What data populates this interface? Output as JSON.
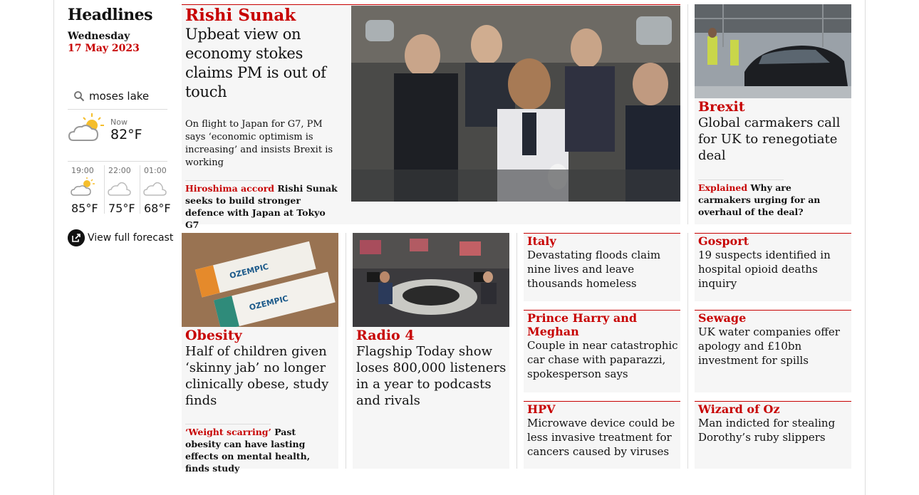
{
  "header": {
    "title": "Headlines",
    "day": "Wednesday",
    "date": "17 May 2023"
  },
  "weather": {
    "location": "moses lake",
    "now": {
      "label": "Now",
      "temp": "82°F",
      "icon": "partly-cloudy-sun-icon"
    },
    "forecast": [
      {
        "time": "19:00",
        "temp": "85°F",
        "icon": "partly-cloudy-sun-icon"
      },
      {
        "time": "22:00",
        "temp": "75°F",
        "icon": "cloudy-moon-icon"
      },
      {
        "time": "01:00",
        "temp": "68°F",
        "icon": "cloudy-moon-icon"
      }
    ],
    "view_full_forecast": "View full forecast"
  },
  "lead": {
    "kicker": "Rishi Sunak",
    "headline": "Upbeat view on economy stokes claims PM is out of touch",
    "standfirst": "On flight to Japan for G7, PM says ‘economic optimism is increasing’ and insists Brexit is working",
    "sublink_kicker": "Hiroshima accord",
    "sublink_text": " Rishi Sunak seeks to build stronger defence with Japan at Tokyo G7"
  },
  "brexit": {
    "kicker": "Brexit",
    "headline": "Global carmakers call for UK to renegotiate deal",
    "sublink_kicker": "Explained",
    "sublink_text": " Why are carmakers urging for an overhaul of the deal?"
  },
  "obesity": {
    "kicker": "Obesity",
    "headline": "Half of children given ‘skinny jab’ no longer clinically obese, study finds",
    "sublink_kicker": "‘Weight scarring’",
    "sublink_text": " Past obesity can have lasting effects on mental health, finds study"
  },
  "radio": {
    "kicker": "Radio 4",
    "headline": "Flagship Today show loses 800,000 listeners in a year to podcasts and rivals"
  },
  "small_stories": [
    {
      "kicker": "Italy",
      "headline": "Devastating floods claim nine lives and leave thousands homeless"
    },
    {
      "kicker": "Gosport",
      "headline": "19 suspects identified in hospital opioid deaths inquiry"
    },
    {
      "kicker": "Prince Harry and Meghan",
      "headline": "Couple in near catastrophic car chase with paparazzi, spokesperson says"
    },
    {
      "kicker": "Sewage",
      "headline": "UK water companies offer apology and £10bn investment for spills"
    },
    {
      "kicker": "HPV",
      "headline": "Microwave device could be less invasive treatment for cancers caused by viruses"
    },
    {
      "kicker": "Wizard of Oz",
      "headline": "Man indicted for stealing Dorothy’s ruby slippers"
    }
  ],
  "colors": {
    "accent": "#c70000",
    "card_bg": "#f6f6f6",
    "text": "#121212",
    "rule": "#dcdcdc"
  }
}
